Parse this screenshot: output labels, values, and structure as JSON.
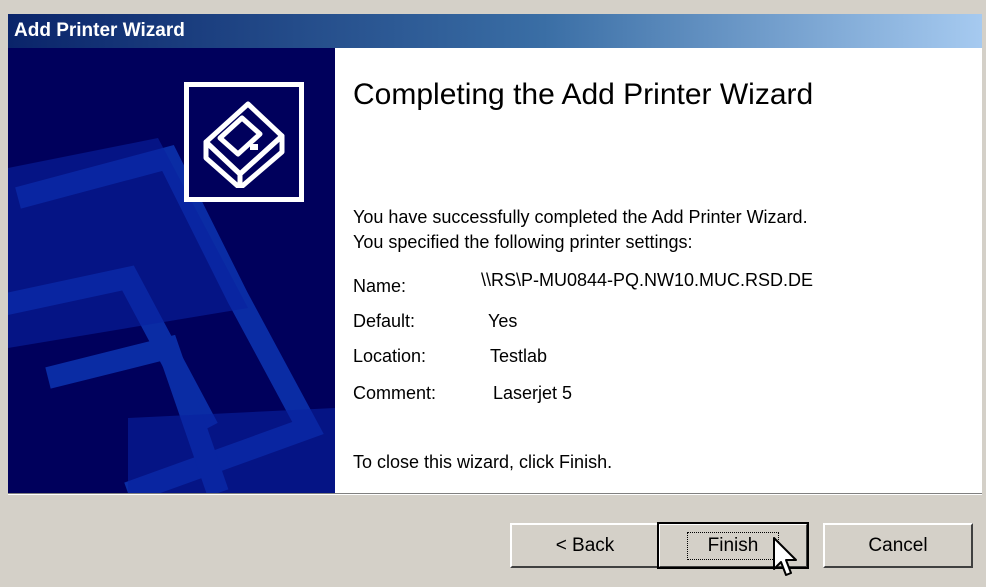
{
  "window": {
    "title": "Add Printer Wizard",
    "title_color_start": "#0a246a",
    "title_color_end": "#a6caf0"
  },
  "banner": {
    "background": "#00005c",
    "icon": "printer-icon"
  },
  "content": {
    "heading": "Completing the Add Printer Wizard",
    "intro_line1": "You have successfully completed the Add Printer Wizard.",
    "intro_line2": "You specified the following printer settings:",
    "settings": [
      {
        "label": "Name:",
        "value": "\\\\RS\\P-MU0844-PQ.NW10.MUC.RSD.DE"
      },
      {
        "label": "Default:",
        "value": "Yes"
      },
      {
        "label": "Location:",
        "value": "Testlab"
      },
      {
        "label": "Comment:",
        "value": "Laserjet 5"
      }
    ],
    "closing": "To close this wizard, click Finish."
  },
  "buttons": {
    "back": "< Back",
    "finish": "Finish",
    "cancel": "Cancel"
  },
  "cursor": "arrow-cursor-icon"
}
